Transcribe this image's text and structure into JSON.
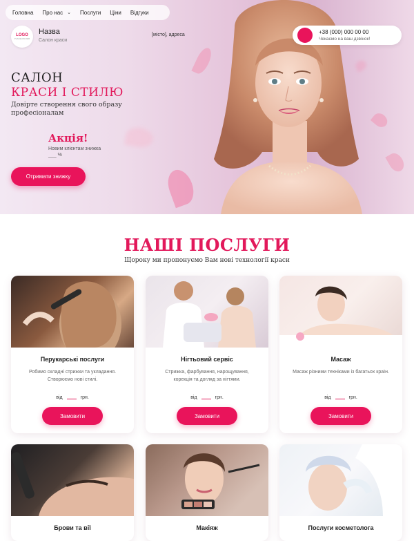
{
  "nav": {
    "items": [
      "Головна",
      "Про нас",
      "Послуги",
      "Ціни",
      "Відгуки"
    ]
  },
  "logo": {
    "text": "LOGO",
    "subtext": "PLACEHOLDER"
  },
  "brand": {
    "name": "Назва",
    "subtitle": "Салон краси"
  },
  "address": "[місто], адреса",
  "contact": {
    "phone": "+38 (000) 000 00 00",
    "callback": "Чекаємо на ваш дзвінок!"
  },
  "hero": {
    "title_line1": "САЛОН",
    "title_line2": "КРАСИ І СТИЛЮ",
    "tagline": "Довірте створення свого образу професіоналам",
    "promo_title": "Акція!",
    "promo_text": "Новим клієнтам знижка ___ %",
    "cta": "Отримати знижку"
  },
  "services": {
    "title": "НАШІ ПОСЛУГИ",
    "subtitle": "Щороку ми пропонуємо Вам нові технології краси",
    "price_from": "від",
    "price_currency": "грн.",
    "order_label": "Замовити",
    "cards": [
      {
        "title": "Перукарські послуги",
        "desc": "Робимо складні стрижки та укладання. Створюємо нові стилі."
      },
      {
        "title": "Нігтьовий сервіс",
        "desc": "Стрижка, фарбування, нарощування, корекція та догляд за нігтями."
      },
      {
        "title": "Масаж",
        "desc": "Масаж різними техніками із багатьох країн."
      }
    ],
    "cards_row2": [
      {
        "title": "Брови та вії"
      },
      {
        "title": "Макіяж"
      },
      {
        "title": "Послуги косметолога"
      }
    ]
  },
  "colors": {
    "accent": "#e2195b",
    "button": "#e9145b"
  }
}
